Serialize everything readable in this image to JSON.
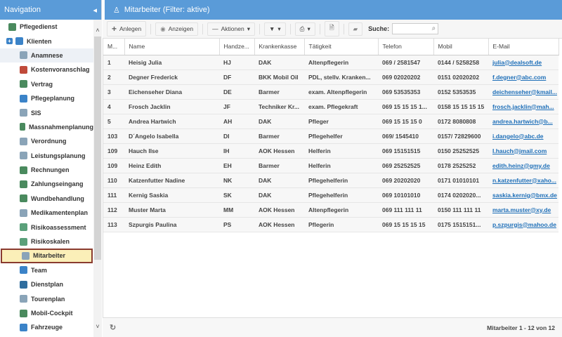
{
  "nav": {
    "title": "Navigation",
    "collapse_icon": "◂",
    "items": [
      {
        "label": "Pflegedienst",
        "level": 0,
        "color": "#4a8a5e"
      },
      {
        "label": "Klienten",
        "level": 0,
        "color": "#3b83c8"
      },
      {
        "label": "Anamnese",
        "level": 1,
        "color": "#8aa4b8"
      },
      {
        "label": "Kostenvoranschlag",
        "level": 1,
        "color": "#c04a3a"
      },
      {
        "label": "Vertrag",
        "level": 1,
        "color": "#4a8a5e"
      },
      {
        "label": "Pflegeplanung",
        "level": 1,
        "color": "#3b83c8"
      },
      {
        "label": "SIS",
        "level": 1,
        "color": "#8aa4b8"
      },
      {
        "label": "Massnahmenplanung",
        "level": 1,
        "color": "#4a8a5e"
      },
      {
        "label": "Verordnung",
        "level": 1,
        "color": "#8aa4b8"
      },
      {
        "label": "Leistungsplanung",
        "level": 1,
        "color": "#8aa4b8"
      },
      {
        "label": "Rechnungen",
        "level": 1,
        "color": "#4a8a5e"
      },
      {
        "label": "Zahlungseingang",
        "level": 1,
        "color": "#4a8a5e"
      },
      {
        "label": "Wundbehandlung",
        "level": 1,
        "color": "#4a8a5e"
      },
      {
        "label": "Medikamentenplan",
        "level": 1,
        "color": "#8aa4b8"
      },
      {
        "label": "Risikoassessment",
        "level": 1,
        "color": "#5aa07a"
      },
      {
        "label": "Risikoskalen",
        "level": 1,
        "color": "#5aa07a"
      },
      {
        "label": "Mitarbeiter",
        "level": 1,
        "color": "#8aa4b8"
      },
      {
        "label": "Team",
        "level": 1,
        "color": "#3b83c8"
      },
      {
        "label": "Dienstplan",
        "level": 1,
        "color": "#2f6d9e"
      },
      {
        "label": "Tourenplan",
        "level": 1,
        "color": "#8aa4b8"
      },
      {
        "label": "Mobil-Cockpit",
        "level": 1,
        "color": "#4a8a5e"
      },
      {
        "label": "Fahrzeuge",
        "level": 1,
        "color": "#3b83c8"
      }
    ]
  },
  "main": {
    "title": "Mitarbeiter (Filter: aktive)",
    "toolbar": {
      "add": "Anlegen",
      "show": "Anzeigen",
      "actions": "Aktionen",
      "search_label": "Suche:",
      "search_value": ""
    },
    "columns": [
      "M...",
      "Name",
      "Handze...",
      "Krankenkasse",
      "Tätigkeit",
      "Telefon",
      "Mobil",
      "E-Mail"
    ],
    "rows": [
      [
        "1",
        "Heisig Julia",
        "HJ",
        "DAK",
        "Altenpflegerin",
        "069 / 2581547",
        "0144 / 5258258",
        "julia@dealsoft.de"
      ],
      [
        "2",
        "Degner Frederick",
        "DF",
        "BKK Mobil Oil",
        "PDL, stellv. Kranken...",
        "069 02020202",
        "0151 02020202",
        "f.degner@abc.com"
      ],
      [
        "3",
        "Eichenseher Diana",
        "DE",
        "Barmer",
        "exam. Altenpflegerin",
        "069 53535353",
        "0152 5353535",
        "deichenseher@kmail..."
      ],
      [
        "4",
        "Frosch Jacklin",
        "JF",
        "Techniker Kr...",
        "exam. Pflegekraft",
        "069 15 15 15 1...",
        "0158 15 15 15 15",
        "frosch.jacklin@mah..."
      ],
      [
        "5",
        "Andrea Hartwich",
        "AH",
        "DAK",
        "Pfleger",
        "069 15 15 15 0",
        "0172 8080808",
        "andrea.hartwich@b..."
      ],
      [
        "103",
        "D´Angelo Isabella",
        "DI",
        "Barmer",
        "Pflegehelfer",
        "069/ 1545410",
        "0157/ 72829600",
        "i.dangelo@abc.de"
      ],
      [
        "109",
        "Hauch Ilse",
        "IH",
        "AOK Hessen",
        "Helferin",
        "069 15151515",
        "0150 25252525",
        "I.hauch@jmail.com"
      ],
      [
        "109",
        "Heinz Edith",
        "EH",
        "Barmer",
        "Helferin",
        "069 25252525",
        "0178 2525252",
        "edith.heinz@gmy.de"
      ],
      [
        "110",
        "Katzenfutter Nadine",
        "NK",
        "DAK",
        "Pflegehelferin",
        "069 20202020",
        "0171 01010101",
        "n.katzenfutter@xaho..."
      ],
      [
        "111",
        "Kernig Saskia",
        "SK",
        "DAK",
        "Pflegehelferin",
        "069 10101010",
        "0174 0202020...",
        "saskia.kernig@bmx.de"
      ],
      [
        "112",
        "Muster Marta",
        "MM",
        "AOK Hessen",
        "Altenpflegerin",
        "069 111 111 11",
        "0150 111 111 11",
        "marta.muster@xy.de"
      ],
      [
        "113",
        "Szpurgis Paulina",
        "PS",
        "AOK Hessen",
        "Pflegerin",
        "069 15 15 15 15",
        "0175 1515151...",
        "p.szpurgis@mahoo.de"
      ]
    ],
    "footer": "Mitarbeiter 1 - 12 von 12"
  }
}
